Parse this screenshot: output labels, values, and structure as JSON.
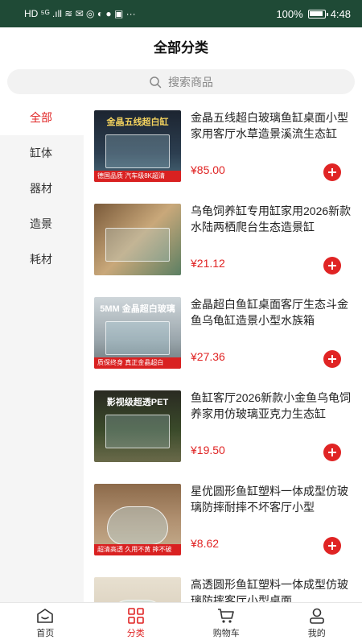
{
  "status_bar": {
    "left_glyphs": "HD ⁵ᴳ .ıll ≋ ✉ ◎ ◐ ● ▣ ···",
    "battery": "100%",
    "time": "4:48"
  },
  "header": {
    "title": "全部分类"
  },
  "search": {
    "placeholder": "搜索商品",
    "icon": "search-icon"
  },
  "sidebar": {
    "items": [
      {
        "label": "全部",
        "active": true
      },
      {
        "label": "缸体",
        "active": false
      },
      {
        "label": "器材",
        "active": false
      },
      {
        "label": "造景",
        "active": false
      },
      {
        "label": "耗材",
        "active": false
      }
    ]
  },
  "products": [
    {
      "title": "金晶五线超白玻璃鱼缸桌面小型家用客厅水草造景溪流生态缸",
      "price": "¥85.00",
      "thumb_text": "金晶五线超白缸",
      "thumb_tag": "德国品质 汽车级8K超清"
    },
    {
      "title": "乌龟饲养缸专用缸家用2026新款水陆两栖爬台生态造景缸",
      "price": "¥21.12",
      "thumb_text": "",
      "thumb_tag": ""
    },
    {
      "title": "金晶超白鱼缸桌面客厅生态斗金鱼乌龟缸造景小型水族箱",
      "price": "¥27.36",
      "thumb_text": "5MM 金晶超白玻璃",
      "thumb_tag": "质保终身 真正金晶超白"
    },
    {
      "title": "鱼缸客厅2026新款小金鱼乌龟饲养家用仿玻璃亚克力生态缸",
      "price": "¥19.50",
      "thumb_text": "影视级超透PET",
      "thumb_tag": ""
    },
    {
      "title": "星优圆形鱼缸塑料一体成型仿玻璃防摔耐摔不坏客厅小型",
      "price": "¥8.62",
      "thumb_text": "",
      "thumb_tag": "超清高透 久用不黄 摔不破"
    },
    {
      "title": "高透圆形鱼缸塑料一体成型仿玻璃防摔客厅小型桌面",
      "price": "",
      "thumb_text": "",
      "thumb_tag": ""
    }
  ],
  "tabbar": {
    "items": [
      {
        "label": "首页",
        "icon": "home-icon",
        "active": false
      },
      {
        "label": "分类",
        "icon": "category-icon",
        "active": true
      },
      {
        "label": "购物车",
        "icon": "cart-icon",
        "active": false
      },
      {
        "label": "我的",
        "icon": "user-icon",
        "active": false
      }
    ]
  },
  "colors": {
    "accent": "#e02424",
    "status_bar": "#1f4a36",
    "sidebar_bg": "#f5f5f5"
  }
}
